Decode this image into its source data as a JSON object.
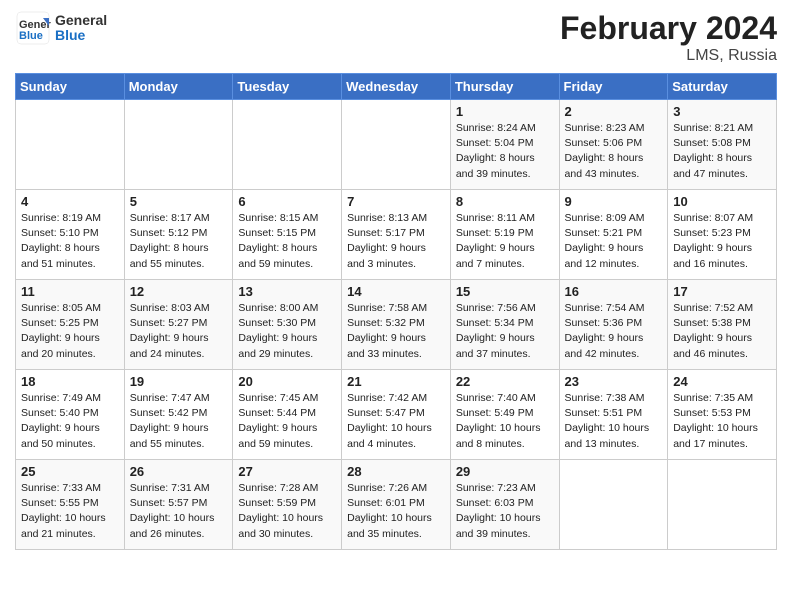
{
  "header": {
    "logo_line1": "General",
    "logo_line2": "Blue",
    "month_year": "February 2024",
    "subtitle": "LMS, Russia"
  },
  "weekdays": [
    "Sunday",
    "Monday",
    "Tuesday",
    "Wednesday",
    "Thursday",
    "Friday",
    "Saturday"
  ],
  "weeks": [
    [
      {
        "day": "",
        "info": ""
      },
      {
        "day": "",
        "info": ""
      },
      {
        "day": "",
        "info": ""
      },
      {
        "day": "",
        "info": ""
      },
      {
        "day": "1",
        "info": "Sunrise: 8:24 AM\nSunset: 5:04 PM\nDaylight: 8 hours\nand 39 minutes."
      },
      {
        "day": "2",
        "info": "Sunrise: 8:23 AM\nSunset: 5:06 PM\nDaylight: 8 hours\nand 43 minutes."
      },
      {
        "day": "3",
        "info": "Sunrise: 8:21 AM\nSunset: 5:08 PM\nDaylight: 8 hours\nand 47 minutes."
      }
    ],
    [
      {
        "day": "4",
        "info": "Sunrise: 8:19 AM\nSunset: 5:10 PM\nDaylight: 8 hours\nand 51 minutes."
      },
      {
        "day": "5",
        "info": "Sunrise: 8:17 AM\nSunset: 5:12 PM\nDaylight: 8 hours\nand 55 minutes."
      },
      {
        "day": "6",
        "info": "Sunrise: 8:15 AM\nSunset: 5:15 PM\nDaylight: 8 hours\nand 59 minutes."
      },
      {
        "day": "7",
        "info": "Sunrise: 8:13 AM\nSunset: 5:17 PM\nDaylight: 9 hours\nand 3 minutes."
      },
      {
        "day": "8",
        "info": "Sunrise: 8:11 AM\nSunset: 5:19 PM\nDaylight: 9 hours\nand 7 minutes."
      },
      {
        "day": "9",
        "info": "Sunrise: 8:09 AM\nSunset: 5:21 PM\nDaylight: 9 hours\nand 12 minutes."
      },
      {
        "day": "10",
        "info": "Sunrise: 8:07 AM\nSunset: 5:23 PM\nDaylight: 9 hours\nand 16 minutes."
      }
    ],
    [
      {
        "day": "11",
        "info": "Sunrise: 8:05 AM\nSunset: 5:25 PM\nDaylight: 9 hours\nand 20 minutes."
      },
      {
        "day": "12",
        "info": "Sunrise: 8:03 AM\nSunset: 5:27 PM\nDaylight: 9 hours\nand 24 minutes."
      },
      {
        "day": "13",
        "info": "Sunrise: 8:00 AM\nSunset: 5:30 PM\nDaylight: 9 hours\nand 29 minutes."
      },
      {
        "day": "14",
        "info": "Sunrise: 7:58 AM\nSunset: 5:32 PM\nDaylight: 9 hours\nand 33 minutes."
      },
      {
        "day": "15",
        "info": "Sunrise: 7:56 AM\nSunset: 5:34 PM\nDaylight: 9 hours\nand 37 minutes."
      },
      {
        "day": "16",
        "info": "Sunrise: 7:54 AM\nSunset: 5:36 PM\nDaylight: 9 hours\nand 42 minutes."
      },
      {
        "day": "17",
        "info": "Sunrise: 7:52 AM\nSunset: 5:38 PM\nDaylight: 9 hours\nand 46 minutes."
      }
    ],
    [
      {
        "day": "18",
        "info": "Sunrise: 7:49 AM\nSunset: 5:40 PM\nDaylight: 9 hours\nand 50 minutes."
      },
      {
        "day": "19",
        "info": "Sunrise: 7:47 AM\nSunset: 5:42 PM\nDaylight: 9 hours\nand 55 minutes."
      },
      {
        "day": "20",
        "info": "Sunrise: 7:45 AM\nSunset: 5:44 PM\nDaylight: 9 hours\nand 59 minutes."
      },
      {
        "day": "21",
        "info": "Sunrise: 7:42 AM\nSunset: 5:47 PM\nDaylight: 10 hours\nand 4 minutes."
      },
      {
        "day": "22",
        "info": "Sunrise: 7:40 AM\nSunset: 5:49 PM\nDaylight: 10 hours\nand 8 minutes."
      },
      {
        "day": "23",
        "info": "Sunrise: 7:38 AM\nSunset: 5:51 PM\nDaylight: 10 hours\nand 13 minutes."
      },
      {
        "day": "24",
        "info": "Sunrise: 7:35 AM\nSunset: 5:53 PM\nDaylight: 10 hours\nand 17 minutes."
      }
    ],
    [
      {
        "day": "25",
        "info": "Sunrise: 7:33 AM\nSunset: 5:55 PM\nDaylight: 10 hours\nand 21 minutes."
      },
      {
        "day": "26",
        "info": "Sunrise: 7:31 AM\nSunset: 5:57 PM\nDaylight: 10 hours\nand 26 minutes."
      },
      {
        "day": "27",
        "info": "Sunrise: 7:28 AM\nSunset: 5:59 PM\nDaylight: 10 hours\nand 30 minutes."
      },
      {
        "day": "28",
        "info": "Sunrise: 7:26 AM\nSunset: 6:01 PM\nDaylight: 10 hours\nand 35 minutes."
      },
      {
        "day": "29",
        "info": "Sunrise: 7:23 AM\nSunset: 6:03 PM\nDaylight: 10 hours\nand 39 minutes."
      },
      {
        "day": "",
        "info": ""
      },
      {
        "day": "",
        "info": ""
      }
    ]
  ]
}
